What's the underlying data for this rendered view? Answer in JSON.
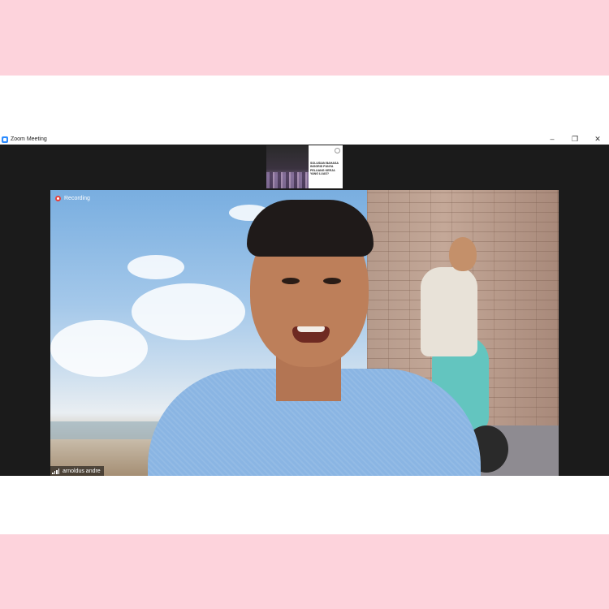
{
  "window": {
    "title": "Zoom Meeting",
    "controls": {
      "minimize": "–",
      "restore": "❐",
      "close": "✕"
    }
  },
  "thumbnail": {
    "slide_text": "SOLUSIAN BAHASA INGGRIS PUNYA PELUANG KERJA YANG LUAS?"
  },
  "video": {
    "recording_label": "Recording",
    "participant_name": "arnoldus andre"
  },
  "colors": {
    "page_background": "#fdd3dc",
    "window_background": "#1b1b1b",
    "recording_dot": "#e8413b"
  },
  "icons": {
    "app": "zoom-logo-icon",
    "recording": "recording-icon",
    "signal": "signal-strength-icon"
  }
}
